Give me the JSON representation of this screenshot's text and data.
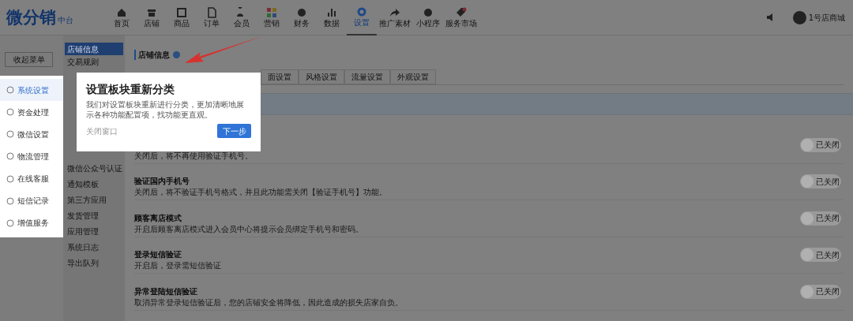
{
  "logo": {
    "name": "微分销",
    "sub": "中台"
  },
  "nav": [
    {
      "label": "首页",
      "selected": false
    },
    {
      "label": "店铺",
      "selected": false
    },
    {
      "label": "商品",
      "selected": false
    },
    {
      "label": "订单",
      "selected": false
    },
    {
      "label": "会员",
      "selected": false
    },
    {
      "label": "营销",
      "selected": false
    },
    {
      "label": "财务",
      "selected": false
    },
    {
      "label": "数据",
      "selected": false
    },
    {
      "label": "设置",
      "selected": true
    },
    {
      "label": "推广素材",
      "selected": false
    },
    {
      "label": "小程序",
      "selected": false
    },
    {
      "label": "服务市场",
      "selected": false
    }
  ],
  "user": {
    "name": "1号店商城"
  },
  "collapse_button": "收起菜单",
  "sidebar": [
    {
      "label": "系统设置",
      "selected": true
    },
    {
      "label": "资金处理",
      "selected": false
    },
    {
      "label": "微信设置",
      "selected": false
    },
    {
      "label": "物流管理",
      "selected": false
    },
    {
      "label": "在线客服",
      "selected": false
    },
    {
      "label": "短信记录",
      "selected": false
    },
    {
      "label": "增值服务",
      "selected": false
    }
  ],
  "submenu_top": [
    {
      "label": "店铺信息",
      "selected": true
    },
    {
      "label": "交易规则",
      "selected": false
    }
  ],
  "submenu_bottom": [
    {
      "label": "微信公众号认证",
      "selected": false
    },
    {
      "label": "通知模板",
      "selected": false
    },
    {
      "label": "第三方应用",
      "selected": false
    },
    {
      "label": "发货管理",
      "selected": false
    },
    {
      "label": "应用管理",
      "selected": false
    },
    {
      "label": "系统日志",
      "selected": false
    },
    {
      "label": "导出队列",
      "selected": false
    }
  ],
  "content": {
    "title": "店铺信息",
    "tabs": [
      {
        "label": "面设置",
        "selected": false
      },
      {
        "label": "风格设置",
        "selected": false
      },
      {
        "label": "流量设置",
        "selected": false
      },
      {
        "label": "外观设置",
        "selected": false
      }
    ],
    "settings": [
      {
        "desc": "关闭后，将不再使用验证手机号。",
        "toggle": "已关闭",
        "on": false
      },
      {
        "title": "验证国内手机号",
        "desc": "关闭后，将不验证手机号格式，并且此功能需关闭【验证手机号】功能。",
        "toggle": "已关闭",
        "on": false
      },
      {
        "title": "顾客离店模式",
        "desc": "开启后顾客离店模式进入会员中心将提示会员绑定手机号和密码。",
        "toggle": "已关闭",
        "on": false
      },
      {
        "title": "登录短信验证",
        "desc": "开启后，登录需短信验证",
        "toggle": "已关闭",
        "on": false
      },
      {
        "title": "异常登陆短信验证",
        "desc": "取消异常登录短信验证后，您的店铺安全将降低，因此造成的损失店家自负。",
        "toggle": "已关闭",
        "on": false
      }
    ]
  },
  "popup": {
    "title": "设置板块重新分类",
    "body": "我们对设置板块重新进行分类，更加清晰地展示各种功能配置项，找功能更直观。",
    "close": "关闭窗口",
    "next": "下一步"
  }
}
